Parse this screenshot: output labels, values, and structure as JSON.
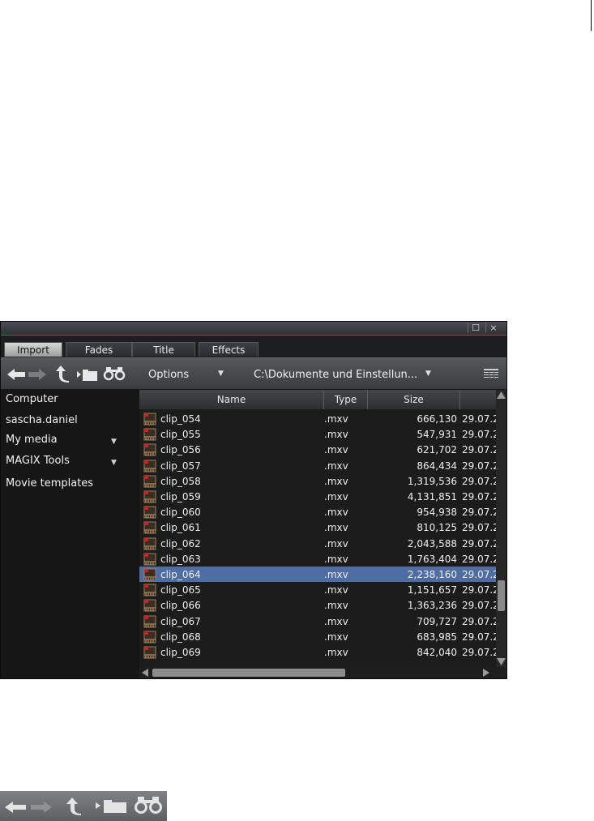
{
  "window": {
    "tabs": [
      "Import",
      "Fades",
      "Title",
      "Effects"
    ],
    "active_tab": "Import"
  },
  "toolbar": {
    "options_label": "Options",
    "path": "C:\\Dokumente und Einstellun...",
    "icons": [
      "arrow-left-icon",
      "arrow-right-icon",
      "folder-up-icon",
      "new-folder-icon",
      "binoculars-icon",
      "view-list-icon"
    ]
  },
  "sidebar": {
    "items": [
      {
        "label": "Computer"
      },
      {
        "label": "sascha.daniel"
      },
      {
        "label": "My media"
      },
      {
        "label": "MAGIX Tools"
      },
      {
        "label": "Movie templates"
      }
    ]
  },
  "list": {
    "columns": [
      "Name",
      "Type",
      "Size"
    ],
    "rows": [
      {
        "name": "clip_054",
        "type": ".mxv",
        "size": "666,130",
        "date": "29.07.2"
      },
      {
        "name": "clip_055",
        "type": ".mxv",
        "size": "547,931",
        "date": "29.07.2"
      },
      {
        "name": "clip_056",
        "type": ".mxv",
        "size": "621,702",
        "date": "29.07.2"
      },
      {
        "name": "clip_057",
        "type": ".mxv",
        "size": "864,434",
        "date": "29.07.2"
      },
      {
        "name": "clip_058",
        "type": ".mxv",
        "size": "1,319,536",
        "date": "29.07.2"
      },
      {
        "name": "clip_059",
        "type": ".mxv",
        "size": "4,131,851",
        "date": "29.07.2"
      },
      {
        "name": "clip_060",
        "type": ".mxv",
        "size": "954,938",
        "date": "29.07.2"
      },
      {
        "name": "clip_061",
        "type": ".mxv",
        "size": "810,125",
        "date": "29.07.2"
      },
      {
        "name": "clip_062",
        "type": ".mxv",
        "size": "2,043,588",
        "date": "29.07.2"
      },
      {
        "name": "clip_063",
        "type": ".mxv",
        "size": "1,763,404",
        "date": "29.07.2"
      },
      {
        "name": "clip_064",
        "type": ".mxv",
        "size": "2,238,160",
        "date": "29.07.2"
      },
      {
        "name": "clip_065",
        "type": ".mxv",
        "size": "1,151,657",
        "date": "29.07.2"
      },
      {
        "name": "clip_066",
        "type": ".mxv",
        "size": "1,363,236",
        "date": "29.07.2"
      },
      {
        "name": "clip_067",
        "type": ".mxv",
        "size": "709,727",
        "date": "29.07.2"
      },
      {
        "name": "clip_068",
        "type": ".mxv",
        "size": "683,985",
        "date": "29.07.2"
      },
      {
        "name": "clip_069",
        "type": ".mxv",
        "size": "842,040",
        "date": "29.07.2"
      }
    ],
    "selected_name": "clip_064"
  },
  "colors": {
    "selection": "#4e6da3",
    "title_accent": "#3463c9",
    "background": "#151515"
  }
}
